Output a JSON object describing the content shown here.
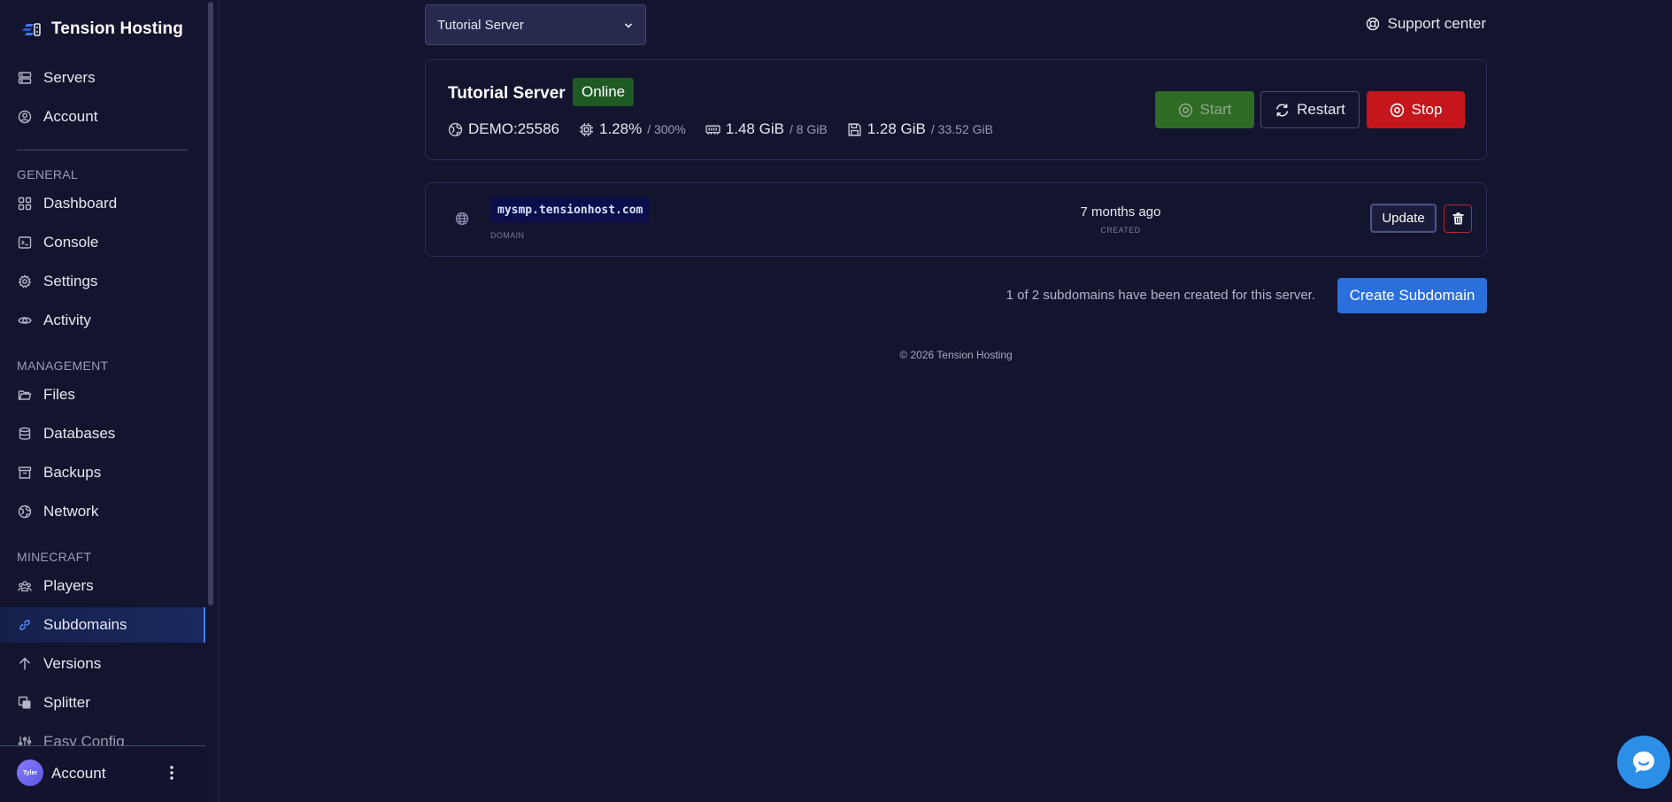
{
  "brand": {
    "title": "Tension Hosting"
  },
  "sidebar": {
    "top_items": [
      {
        "label": "Servers",
        "icon": "server-icon"
      },
      {
        "label": "Account",
        "icon": "user-circle-icon"
      }
    ],
    "sections": [
      {
        "label": "GENERAL",
        "items": [
          {
            "label": "Dashboard",
            "icon": "grid-icon"
          },
          {
            "label": "Console",
            "icon": "terminal-icon"
          },
          {
            "label": "Settings",
            "icon": "gear-icon"
          },
          {
            "label": "Activity",
            "icon": "eye-icon"
          }
        ]
      },
      {
        "label": "MANAGEMENT",
        "items": [
          {
            "label": "Files",
            "icon": "folder-icon"
          },
          {
            "label": "Databases",
            "icon": "database-icon"
          },
          {
            "label": "Backups",
            "icon": "archive-icon"
          },
          {
            "label": "Network",
            "icon": "network-globe-icon"
          }
        ]
      },
      {
        "label": "MINECRAFT",
        "items": [
          {
            "label": "Players",
            "icon": "players-icon"
          },
          {
            "label": "Subdomains",
            "icon": "link-icon",
            "active": true
          },
          {
            "label": "Versions",
            "icon": "arrow-up-icon"
          },
          {
            "label": "Splitter",
            "icon": "copy-icon"
          },
          {
            "label": "Easy Config",
            "icon": "sliders-icon"
          }
        ]
      }
    ],
    "footer": {
      "avatar_text": "Tyler",
      "label": "Account"
    }
  },
  "topbar": {
    "server_select": {
      "value": "Tutorial Server"
    },
    "support_label": "Support center"
  },
  "server": {
    "name": "Tutorial Server",
    "status": "Online",
    "address": "DEMO:25586",
    "cpu": {
      "value": "1.28%",
      "limit": "/ 300%"
    },
    "memory": {
      "value": "1.48 GiB",
      "limit": "/ 8 GiB"
    },
    "disk": {
      "value": "1.28 GiB",
      "limit": "/ 33.52 GiB"
    },
    "buttons": {
      "start": "Start",
      "restart": "Restart",
      "stop": "Stop"
    }
  },
  "subdomains": {
    "rows": [
      {
        "domain": "mysmp.tensionhost.com",
        "domain_caption": "DOMAIN",
        "created": "7 months ago",
        "created_caption": "CREATED",
        "update_label": "Update"
      }
    ],
    "count_text": "1 of 2 subdomains have been created for this server.",
    "create_label": "Create Subdomain"
  },
  "footer": {
    "copyright": "© 2026 Tension Hosting"
  },
  "colors": {
    "accent": "#2a6fdb",
    "online": "#1f5a25",
    "stop": "#c4161c",
    "start": "#2f6b24",
    "background": "#13142e"
  }
}
